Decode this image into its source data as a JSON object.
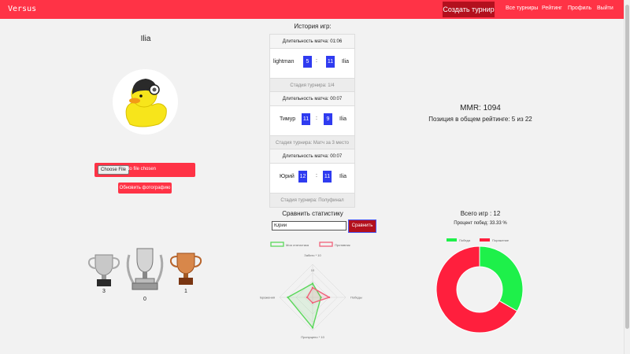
{
  "nav": {
    "brand": "Versus",
    "create_tournament": "Создать турнир",
    "all_tournaments": "Все турниры",
    "rating": "Рейтинг",
    "profile": "Профиль",
    "logout": "Выйти"
  },
  "profile": {
    "name": "Ilia",
    "file_button": "Choose File",
    "file_status": "No file chosen",
    "update_photo": "Обновить фотографию",
    "trophies": [
      {
        "name": "silver-trophy",
        "count": "3"
      },
      {
        "name": "laurel-trophy",
        "count": "0"
      },
      {
        "name": "bronze-trophy",
        "count": "1"
      }
    ]
  },
  "history": {
    "title": "История игр:",
    "matches": [
      {
        "duration": "Длительность матча: 01:06",
        "player1": "lightman",
        "score1": "5",
        "score2": "11",
        "player2": "Ilia",
        "stage": "Стадия турнира: 1/4"
      },
      {
        "duration": "Длительность матча: 00:07",
        "player1": "Тимур",
        "score1": "11",
        "score2": "9",
        "player2": "Ilia",
        "stage": "Стадия турнира: Матч за 3 место"
      },
      {
        "duration": "Длительность матча: 00:07",
        "player1": "Юрий",
        "score1": "12",
        "score2": "11",
        "player2": "Ilia",
        "stage": "Стадия турнира: Полуфинал"
      }
    ]
  },
  "compare": {
    "title": "Сравнить статистику",
    "input_value": "Юрий",
    "button": "Сравнить"
  },
  "stats": {
    "mmr": "MMR: 1094",
    "rank": "Позиция в общем рейтинге: 5 из 22",
    "games_total": "Всего игр : 12",
    "win_pct": "Процент побед: 33.33 %"
  },
  "colors": {
    "nav": "#ff3346",
    "accent_dark": "#b3101d",
    "score_box": "#2f3bf0",
    "win_green": "#1ef04a",
    "loss_red": "#ff1f3d",
    "radar_green": "#5ad85a",
    "radar_red": "#f0627a"
  },
  "chart_data": [
    {
      "type": "radar",
      "legend": [
        "Моя статистика",
        "Противник"
      ],
      "axes": [
        "Забито * 10",
        "Победы",
        "Пропущено * 10",
        "Поражения"
      ],
      "tick_labels": [
        "10",
        "5"
      ],
      "series": [
        {
          "name": "Моя статистика",
          "values": [
            5,
            3,
            11,
            9
          ]
        },
        {
          "name": "Противник",
          "values": [
            3.5,
            6,
            2,
            2
          ]
        }
      ],
      "rmax": 12
    },
    {
      "type": "pie",
      "legend": [
        "Победа",
        "Поражение"
      ],
      "categories": [
        "Победа",
        "Поражение"
      ],
      "values": [
        4,
        8
      ]
    }
  ]
}
